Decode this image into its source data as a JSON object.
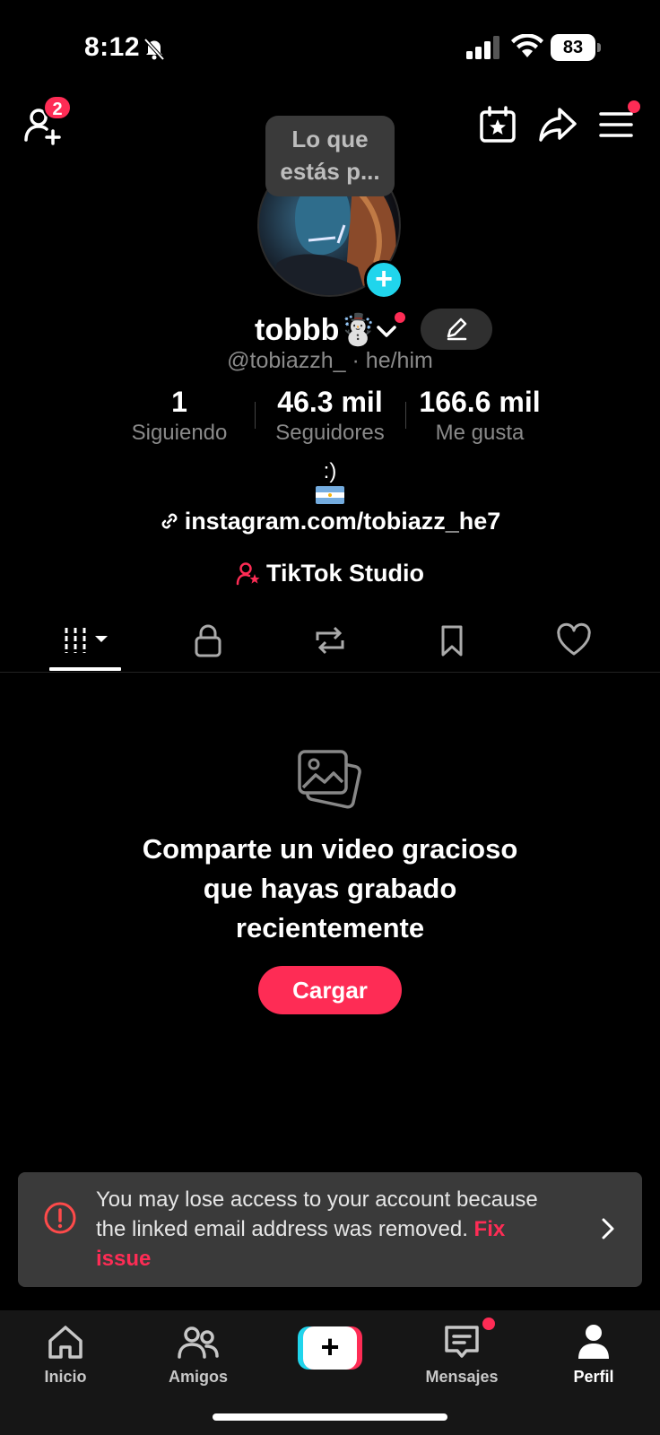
{
  "status_bar": {
    "time": "8:12",
    "battery": "83"
  },
  "top_nav": {
    "friend_badge": "2"
  },
  "tooltip": {
    "text": "Lo que estás p..."
  },
  "profile": {
    "display_name": "tobbb☃️",
    "handle": "@tobiazzh_ · he/him",
    "stats": [
      {
        "value": "1",
        "label": "Siguiendo"
      },
      {
        "value": "46.3 mil",
        "label": "Seguidores"
      },
      {
        "value": "166.6 mil",
        "label": "Me gusta"
      }
    ],
    "bio": ":)",
    "link": "instagram.com/tobiazz_he7",
    "studio": "TikTok Studio"
  },
  "empty_state": {
    "title_line1": "Comparte un video gracioso",
    "title_line2": "que hayas grabado",
    "title_line3": "recientemente",
    "button": "Cargar"
  },
  "warning": {
    "message": "You may lose access to your account because the linked email address was removed.",
    "link": "Fix issue"
  },
  "bottom_nav": {
    "items": [
      {
        "label": "Inicio",
        "icon": "home-icon"
      },
      {
        "label": "Amigos",
        "icon": "friends-icon"
      },
      {
        "label": "Mensajes",
        "icon": "inbox-icon"
      },
      {
        "label": "Perfil",
        "icon": "profile-icon"
      }
    ]
  },
  "colors": {
    "accent": "#fe2c55",
    "cyan": "#20d5ec",
    "banner": "#3a3a3a"
  }
}
